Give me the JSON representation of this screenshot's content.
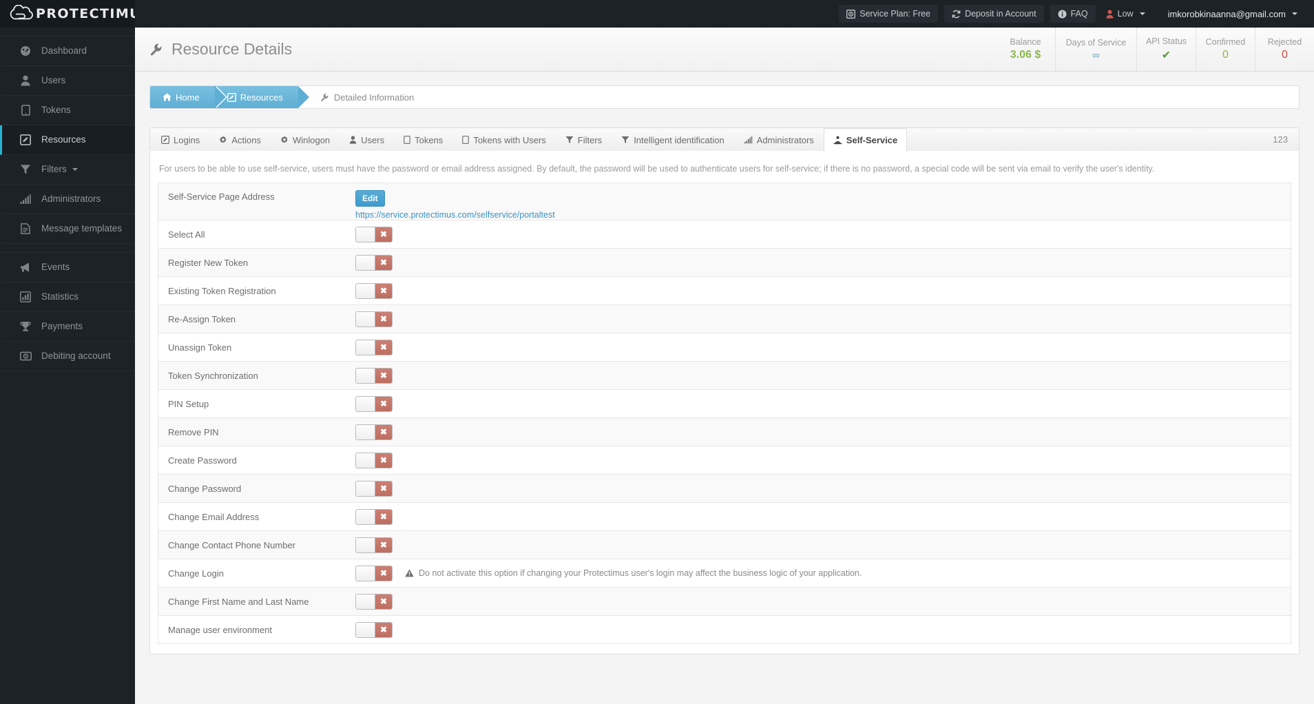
{
  "brand": {
    "name": "PROTECTIMUS",
    "logo_icon": "cloud-lock-logo"
  },
  "topbar": {
    "service_plan": "Service Plan: Free",
    "deposit": "Deposit in Account",
    "faq": "FAQ",
    "balance_level": "Low",
    "user_email": "imkorobkinaanna@gmail.com",
    "icons": {
      "service_plan": "coin-icon",
      "deposit": "refresh-icon",
      "faq": "info-icon",
      "level": "user-icon",
      "caret": "chevron-down-icon"
    }
  },
  "sidebar": {
    "items": [
      {
        "label": "Dashboard",
        "icon": "dashboard-icon",
        "active": false,
        "caret": false
      },
      {
        "label": "Users",
        "icon": "user-icon",
        "active": false,
        "caret": false
      },
      {
        "label": "Tokens",
        "icon": "token-device-icon",
        "active": false,
        "caret": false
      },
      {
        "label": "Resources",
        "icon": "edit-square-icon",
        "active": true,
        "caret": false
      },
      {
        "label": "Filters",
        "icon": "funnel-icon",
        "active": false,
        "caret": true
      },
      {
        "label": "Administrators",
        "icon": "bars-icon",
        "active": false,
        "caret": false
      },
      {
        "label": "Message templates",
        "icon": "document-icon",
        "active": false,
        "caret": false
      }
    ],
    "items2": [
      {
        "label": "Events",
        "icon": "megaphone-icon",
        "active": false,
        "caret": false
      },
      {
        "label": "Statistics",
        "icon": "chart-icon",
        "active": false,
        "caret": false
      },
      {
        "label": "Payments",
        "icon": "trophy-icon",
        "active": false,
        "caret": false
      },
      {
        "label": "Debiting account",
        "icon": "banknote-icon",
        "active": false,
        "caret": false
      }
    ]
  },
  "page": {
    "title": "Resource Details",
    "title_icon": "wrench-icon"
  },
  "stats": [
    {
      "key": "Balance",
      "value": "3.06 $",
      "style": "green",
      "wide": false
    },
    {
      "key": "Days of Service",
      "value": "∞",
      "style": "blue",
      "wide": true
    },
    {
      "key": "API Status",
      "value": "✔",
      "style": "check",
      "wide": false
    },
    {
      "key": "Confirmed",
      "value": "0",
      "style": "green",
      "wide": false
    },
    {
      "key": "Rejected",
      "value": "0",
      "style": "red",
      "wide": false
    }
  ],
  "breadcrumb": {
    "items": [
      {
        "label": "Home",
        "icon": "home-icon",
        "type": "chevron"
      },
      {
        "label": "Resources",
        "icon": "edit-square-icon",
        "type": "chevron"
      },
      {
        "label": "Detailed Information",
        "icon": "wrench-icon",
        "type": "plain"
      }
    ]
  },
  "tabs": {
    "count_badge": "123",
    "items": [
      {
        "label": "Logins",
        "icon": "edit-square-icon",
        "active": false
      },
      {
        "label": "Actions",
        "icon": "gear-icon",
        "active": false
      },
      {
        "label": "Winlogon",
        "icon": "gear-icon",
        "active": false
      },
      {
        "label": "Users",
        "icon": "user-icon",
        "active": false
      },
      {
        "label": "Tokens",
        "icon": "token-device-icon",
        "active": false
      },
      {
        "label": "Tokens with Users",
        "icon": "token-device-icon",
        "active": false
      },
      {
        "label": "Filters",
        "icon": "funnel-icon",
        "active": false
      },
      {
        "label": "Intelligent identification",
        "icon": "funnel-icon",
        "active": false
      },
      {
        "label": "Administrators",
        "icon": "bars-icon",
        "active": false
      },
      {
        "label": "Self-Service",
        "icon": "self-service-icon",
        "active": true
      }
    ]
  },
  "panel": {
    "note": "For users to be able to use self-service, users must have the password or email address assigned. By default, the password will be used to authenticate users for self-service; if there is no password, a special code will be sent via email to verify the user's identity.",
    "address_row": {
      "label": "Self-Service Page Address",
      "edit_label": "Edit",
      "url": "https://service.protectimus.com/selfservice/portaltest"
    },
    "toggle_off_glyph": "✖",
    "rows": [
      {
        "label": "Select All",
        "state": "off",
        "warning": ""
      },
      {
        "label": "Register New Token",
        "state": "off",
        "warning": ""
      },
      {
        "label": "Existing Token Registration",
        "state": "off",
        "warning": ""
      },
      {
        "label": "Re-Assign Token",
        "state": "off",
        "warning": ""
      },
      {
        "label": "Unassign Token",
        "state": "off",
        "warning": ""
      },
      {
        "label": "Token Synchronization",
        "state": "off",
        "warning": ""
      },
      {
        "label": "PIN Setup",
        "state": "off",
        "warning": ""
      },
      {
        "label": "Remove PIN",
        "state": "off",
        "warning": ""
      },
      {
        "label": "Create Password",
        "state": "off",
        "warning": ""
      },
      {
        "label": "Change Password",
        "state": "off",
        "warning": ""
      },
      {
        "label": "Change Email Address",
        "state": "off",
        "warning": ""
      },
      {
        "label": "Change Contact Phone Number",
        "state": "off",
        "warning": ""
      },
      {
        "label": "Change Login",
        "state": "off",
        "warning": "Do not activate this option if changing your Protectimus user's login may affect the business logic of your application."
      },
      {
        "label": "Change First Name and Last Name",
        "state": "off",
        "warning": ""
      },
      {
        "label": "Manage user environment",
        "state": "off",
        "warning": ""
      }
    ]
  },
  "colors": {
    "sidebar_bg": "#1d2226",
    "accent_cyan": "#29b3d2",
    "breadcrumb_blue": "#5eaed4",
    "toggle_off_red": "#be6e61",
    "balance_green": "#8bb84a",
    "rejected_red": "#cf4a3f",
    "link_blue": "#3b92c4"
  }
}
